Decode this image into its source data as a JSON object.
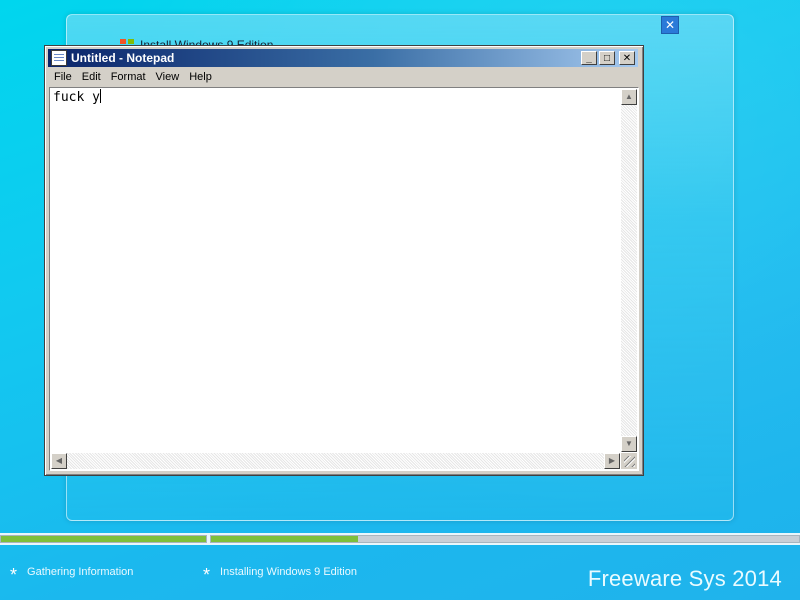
{
  "installer": {
    "title": "Install Windows 9 Edition",
    "close_glyph": "✕"
  },
  "notepad": {
    "title": "Untitled - Notepad",
    "menu": [
      "File",
      "Edit",
      "Format",
      "View",
      "Help"
    ],
    "content": "fuck y",
    "controls": {
      "minimize": "_",
      "maximize": "□",
      "close": "✕"
    }
  },
  "progress": {
    "steps": [
      {
        "label": "Gathering Information",
        "progress": 1.0
      },
      {
        "label": "Installing Windows 9 Edition",
        "progress": 0.25
      }
    ]
  },
  "brand": "Freeware Sys 2014",
  "colors": {
    "accent_green": "#7dbf3c",
    "title_blue": "#0a246a",
    "background_cyan": "#12c9f0"
  }
}
